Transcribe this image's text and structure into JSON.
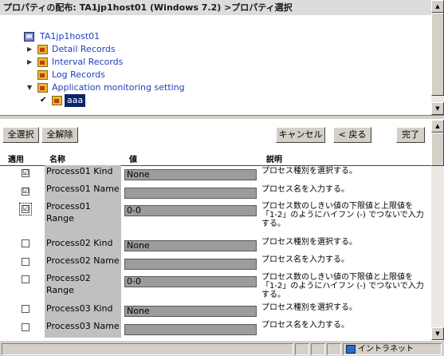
{
  "top": {
    "title": "プロパティの配布: TA1jp1host01 (Windows 7.2) >プロパティ選択",
    "tree": {
      "host": "TA1jp1host01",
      "items": [
        "Detail Records",
        "Interval Records",
        "Log Records",
        "Application monitoring setting"
      ],
      "selected": "aaa"
    }
  },
  "toolbar": {
    "select_all": "全選択",
    "deselect_all": "全解除",
    "cancel": "キャンセル",
    "back": "< 戻る",
    "finish": "完了"
  },
  "table": {
    "headers": [
      "適用",
      "名称",
      "値",
      "説明"
    ],
    "rows": [
      {
        "checked": "☑",
        "name": "Process01 Kind",
        "value": "None",
        "desc": "プロセス種別を選択する。"
      },
      {
        "checked": "☑",
        "name": "Process01 Name",
        "value": "",
        "desc": "プロセス名を入力する。"
      },
      {
        "checked": "☑",
        "name": "Process01 Range",
        "value": "0-0",
        "desc": "プロセス数のしきい値の下限値と上限値を「1-2」のようにハイフン (-) でつないで入力する。"
      },
      {
        "checked": "",
        "name": "Process02 Kind",
        "value": "None",
        "desc": "プロセス種別を選択する。"
      },
      {
        "checked": "",
        "name": "Process02 Name",
        "value": "",
        "desc": "プロセス名を入力する。"
      },
      {
        "checked": "",
        "name": "Process02 Range",
        "value": "0-0",
        "desc": "プロセス数のしきい値の下限値と上限値を「1-2」のようにハイフン (-) でつないで入力する。"
      },
      {
        "checked": "",
        "name": "Process03 Kind",
        "value": "None",
        "desc": "プロセス種別を選択する。"
      },
      {
        "checked": "",
        "name": "Process03 Name",
        "value": "",
        "desc": "プロセス名を入力する。"
      }
    ]
  },
  "status": {
    "zone": "イントラネット"
  },
  "icons": {
    "tree_expand": "triangle-right-icon",
    "tree_collapse": "triangle-down-icon",
    "check": "checkmark-icon",
    "host": "computer-icon",
    "folder": "folder-icon",
    "zone": "intranet-icon"
  }
}
